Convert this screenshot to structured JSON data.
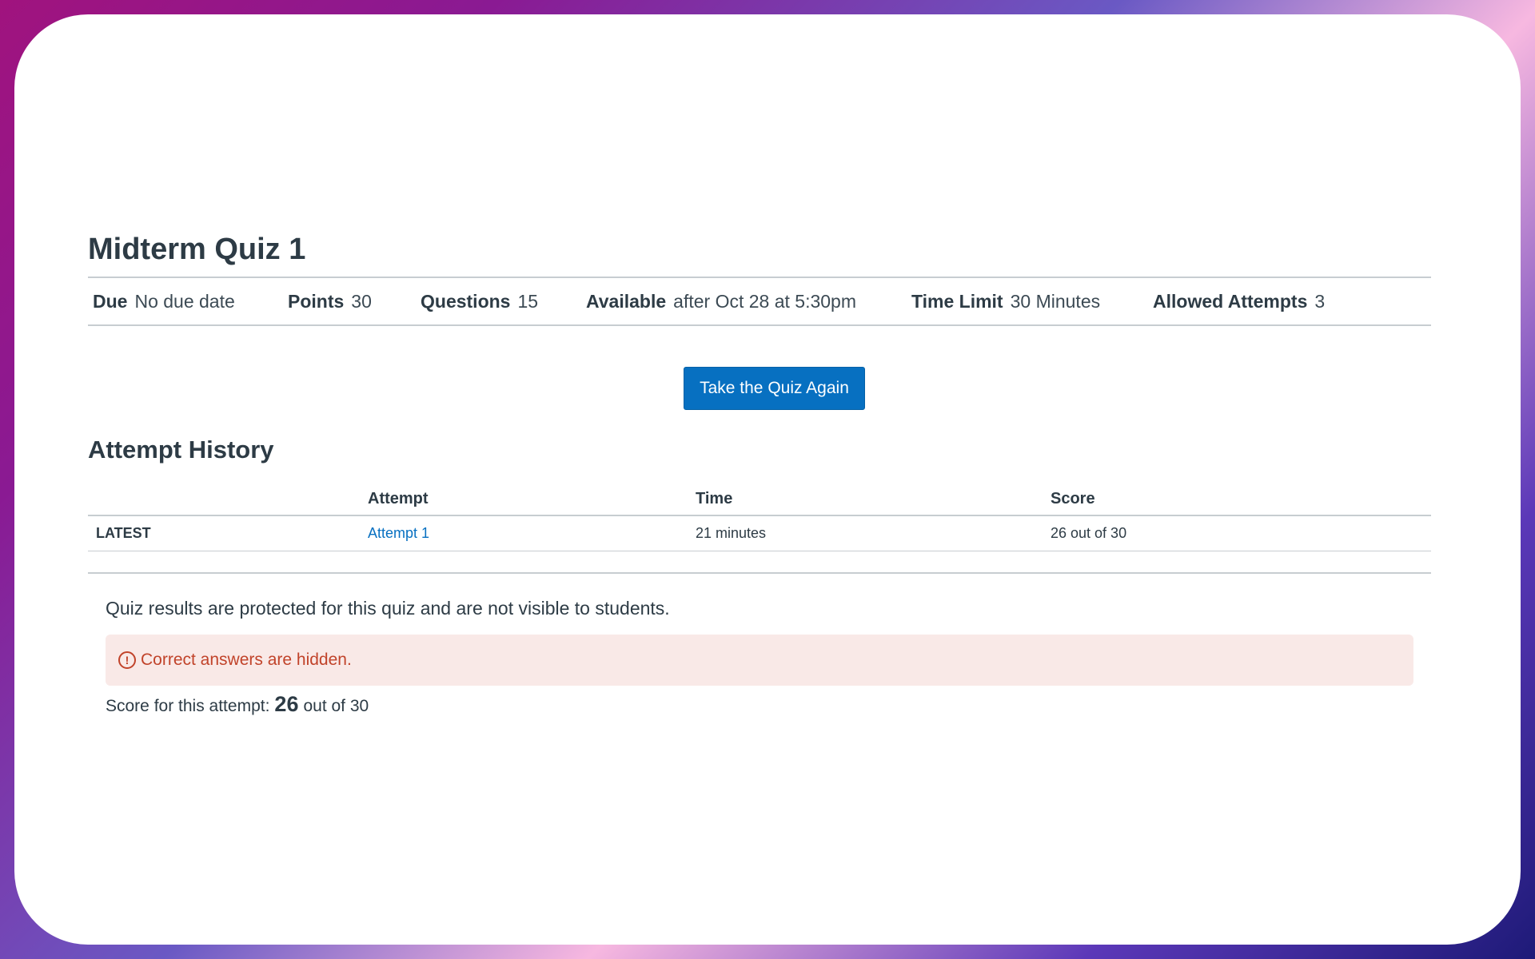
{
  "quiz": {
    "title": "Midterm Quiz 1",
    "details": {
      "due_label": "Due",
      "due_value": "No due date",
      "points_label": "Points",
      "points_value": "30",
      "questions_label": "Questions",
      "questions_value": "15",
      "available_label": "Available",
      "available_value": "after Oct 28 at 5:30pm",
      "time_limit_label": "Time Limit",
      "time_limit_value": "30 Minutes",
      "attempts_label": "Allowed Attempts",
      "attempts_value": "3"
    },
    "take_again_label": "Take the Quiz Again"
  },
  "history": {
    "title": "Attempt History",
    "headers": [
      "",
      "Attempt",
      "Time",
      "Score"
    ],
    "rows": [
      {
        "tag": "LATEST",
        "attempt": "Attempt 1",
        "time": "21 minutes",
        "score": "26 out of 30"
      }
    ]
  },
  "results": {
    "protected_text": "Quiz results are protected for this quiz and are not visible to students.",
    "alert_icon": "exclamation-circle-icon",
    "alert_text": "Correct answers are hidden.",
    "score_prefix": "Score for this attempt:",
    "score_value": "26",
    "score_suffix": "out of 30"
  },
  "colors": {
    "accent": "#0770c1",
    "alert_bg": "#f9e9e7",
    "alert_text": "#c1432a",
    "text": "#2d3b45"
  }
}
